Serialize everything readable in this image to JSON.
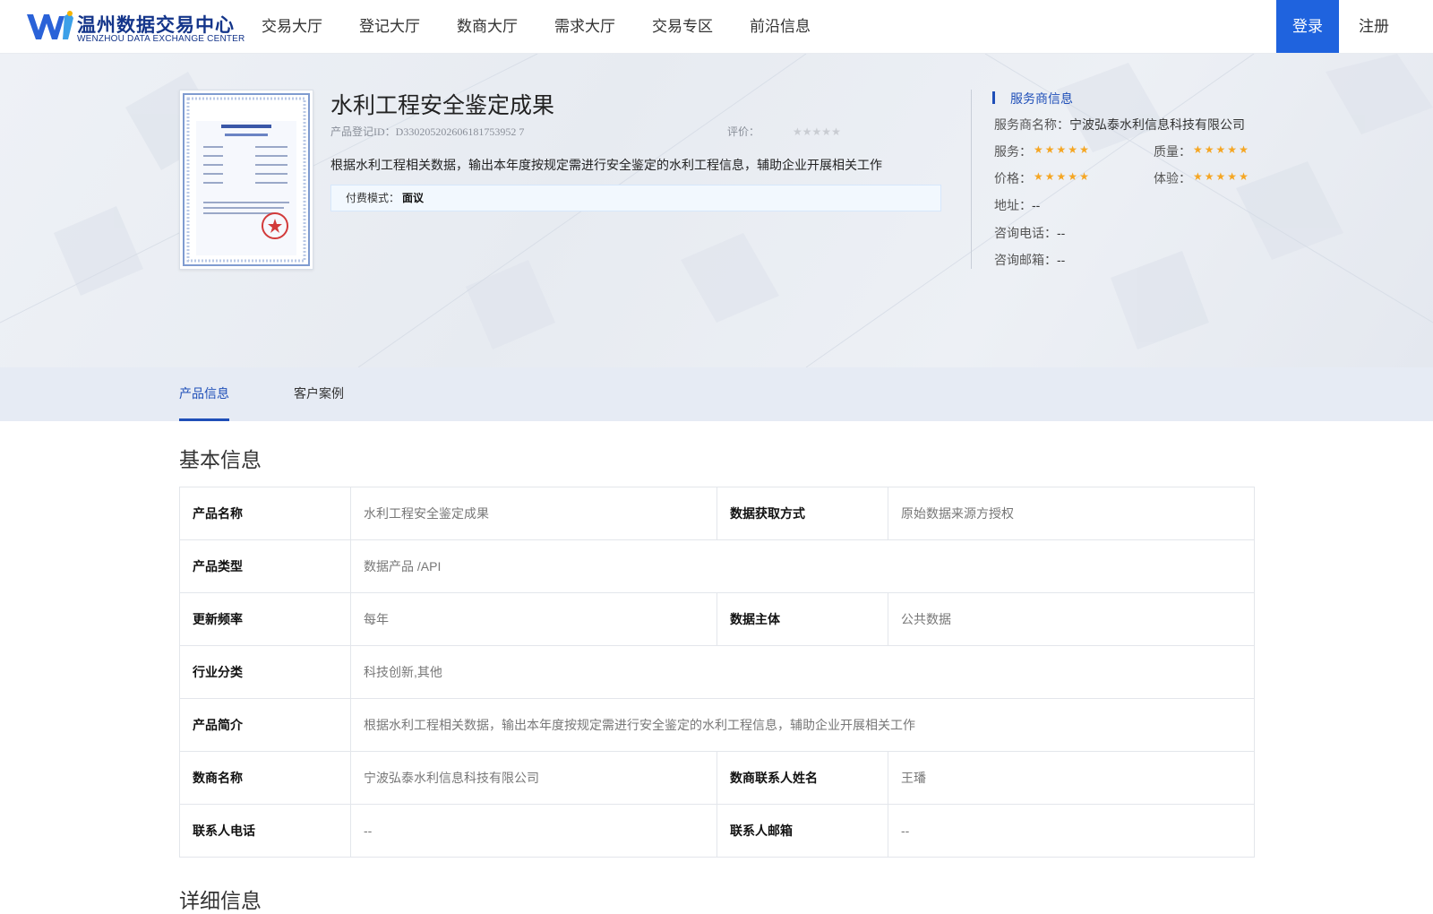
{
  "header": {
    "logo_cn": "温州数据交易中心",
    "logo_en": "WENZHOU DATA EXCHANGE CENTER",
    "nav": [
      "交易大厅",
      "登记大厅",
      "数商大厅",
      "需求大厅",
      "交易专区",
      "前沿信息"
    ],
    "login_label": "登录",
    "register_label": "注册",
    "accent_color": "#1f63de"
  },
  "product": {
    "title": "水利工程安全鉴定成果",
    "id_label": "产品登记ID：",
    "id_value": "D330205202606181753952 7",
    "rating_label": "评价：",
    "rating_value": 0,
    "rating_max": 5,
    "description": "根据水利工程相关数据，输出本年度按规定需进行安全鉴定的水利工程信息，辅助企业开展相关工作",
    "pay_mode_label": "付费模式：",
    "pay_mode_value": "面议"
  },
  "provider": {
    "section_title": "服务商信息",
    "name_label": "服务商名称：",
    "name_value": "宁波弘泰水利信息科技有限公司",
    "ratings": [
      {
        "label": "服务：",
        "stars": 5
      },
      {
        "label": "质量：",
        "stars": 5
      },
      {
        "label": "价格：",
        "stars": 5
      },
      {
        "label": "体验：",
        "stars": 5
      }
    ],
    "address_label": "地址：",
    "address_value": "--",
    "phone_label": "咨询电话：",
    "phone_value": "--",
    "email_label": "咨询邮箱：",
    "email_value": "--"
  },
  "tabs": [
    "产品信息",
    "客户案例"
  ],
  "basic_info": {
    "title": "基本信息",
    "rows": [
      {
        "k1": "产品名称",
        "v1": "水利工程安全鉴定成果",
        "k2": "数据获取方式",
        "v2": "原始数据来源方授权"
      },
      {
        "k1": "产品类型",
        "v1": "数据产品 /API"
      },
      {
        "k1": "更新频率",
        "v1": "每年",
        "k2": "数据主体",
        "v2": "公共数据"
      },
      {
        "k1": "行业分类",
        "v1": "科技创新,其他"
      },
      {
        "k1": "产品简介",
        "v1": "根据水利工程相关数据，输出本年度按规定需进行安全鉴定的水利工程信息，辅助企业开展相关工作"
      },
      {
        "k1": "数商名称",
        "v1": "宁波弘泰水利信息科技有限公司",
        "k2": "数商联系人姓名",
        "v2": "王璠"
      },
      {
        "k1": "联系人电话",
        "v1": "--",
        "k2": "联系人邮箱",
        "v2": "--"
      }
    ]
  },
  "detail_info": {
    "title": "详细信息"
  }
}
